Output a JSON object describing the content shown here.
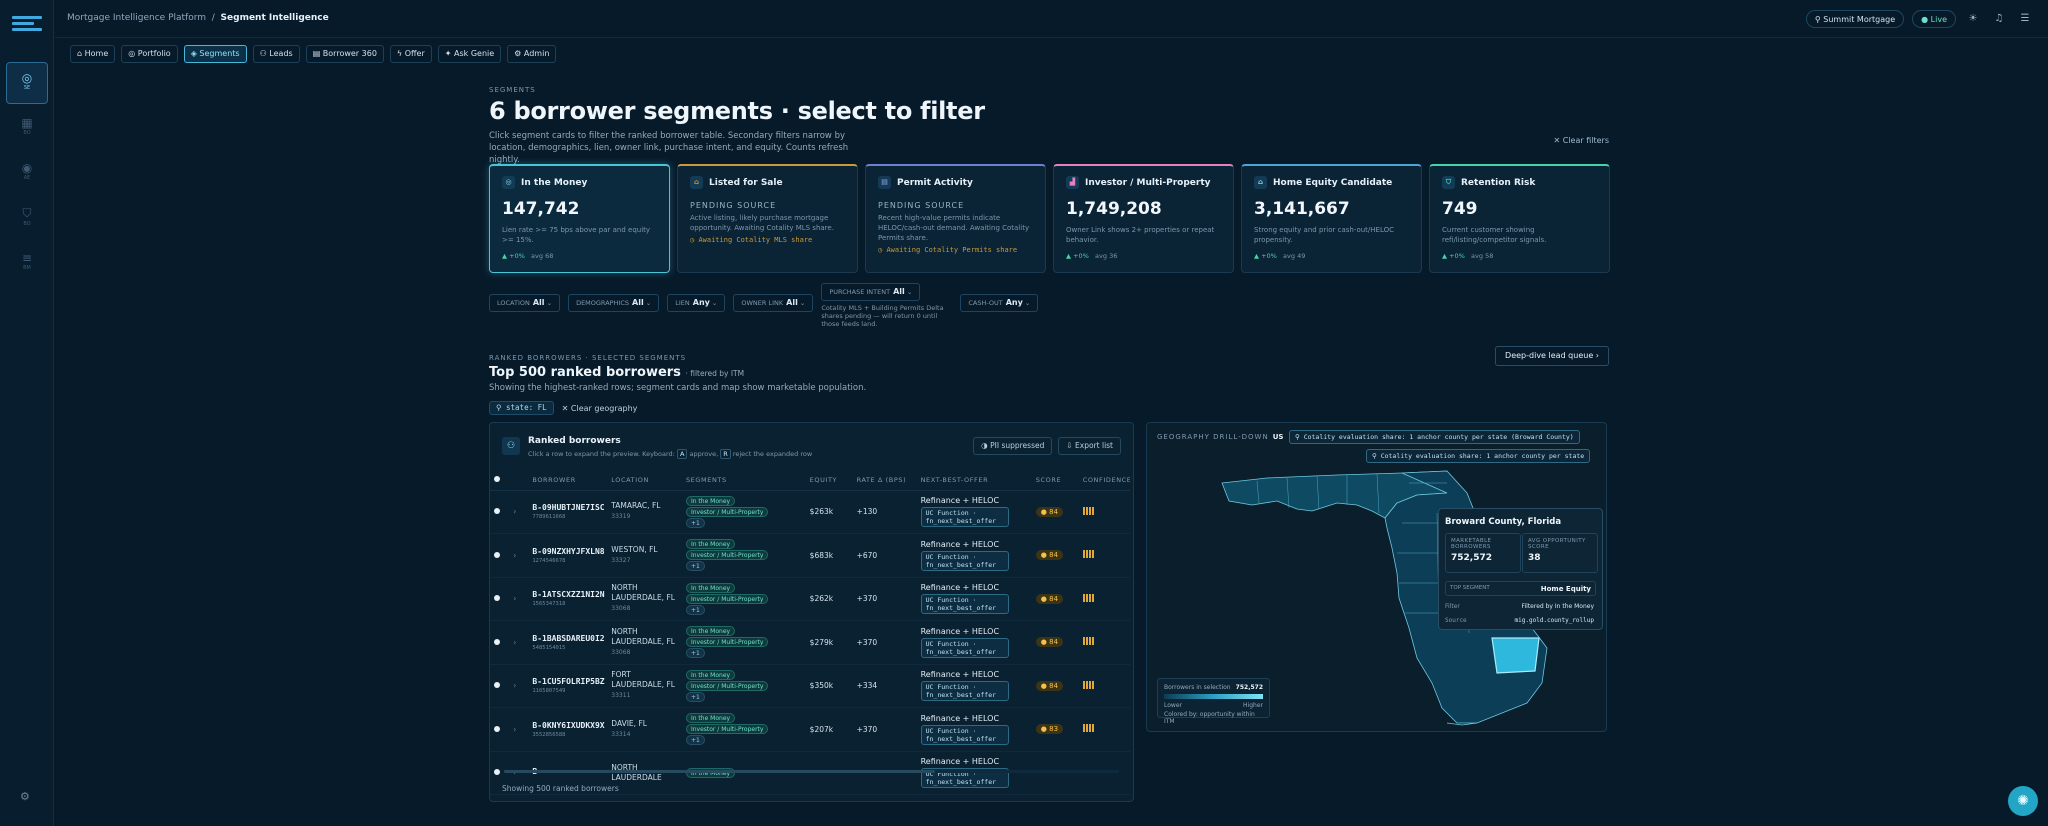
{
  "sidebar": {
    "items": [
      {
        "icon": "target-icon",
        "label": "SE"
      },
      {
        "icon": "grid-icon",
        "label": "BO"
      },
      {
        "icon": "brain-icon",
        "label": "AE"
      },
      {
        "icon": "shield-icon",
        "label": "BO"
      },
      {
        "icon": "sliders-icon",
        "label": "BM"
      }
    ]
  },
  "breadcrumb": {
    "root": "Mortgage Intelligence Platform",
    "sep": "/",
    "current": "Segment Intelligence"
  },
  "topbar": {
    "tenant": "Summit Mortgage",
    "status": "Live"
  },
  "tabs": [
    "Home",
    "Portfolio",
    "Segments",
    "Leads",
    "Borrower 360",
    "Offer",
    "Ask Genie",
    "Admin"
  ],
  "header": {
    "eyebrow": "SEGMENTS",
    "title": "6 borrower segments · select to filter",
    "subtitle": "Click segment cards to filter the ranked borrower table. Secondary filters narrow by location, demographics, lien, owner link, purchase intent, and equity. Counts refresh nightly.",
    "clear": "Clear filters"
  },
  "cards": [
    {
      "title": "In the Money",
      "value": "147,742",
      "desc": "Lien rate >= 75 bps above par and equity >= 15%.",
      "delta": "+0%",
      "avg": "avg 68",
      "accent": "#49c4d8"
    },
    {
      "title": "Listed for Sale",
      "pending": "PENDING SOURCE",
      "desc": "Active listing, likely purchase mortgage opportunity. Awaiting Cotality MLS share.",
      "await": "Awaiting Cotality MLS share",
      "accent": "#c99a3a"
    },
    {
      "title": "Permit Activity",
      "pending": "PENDING SOURCE",
      "desc": "Recent high-value permits indicate HELOC/cash-out demand. Awaiting Cotality Permits share.",
      "await": "Awaiting Cotality Permits share",
      "accent": "#6f7fd6"
    },
    {
      "title": "Investor / Multi-Property",
      "value": "1,749,208",
      "desc": "Owner Link shows 2+ properties or repeat behavior.",
      "delta": "+0%",
      "avg": "avg 36",
      "accent": "#e77fc0"
    },
    {
      "title": "Home Equity Candidate",
      "value": "3,141,667",
      "desc": "Strong equity and prior cash-out/HELOC propensity.",
      "delta": "+0%",
      "avg": "avg 49",
      "accent": "#4fa4d6"
    },
    {
      "title": "Retention Risk",
      "value": "749",
      "desc": "Current customer showing refi/listing/competitor signals.",
      "delta": "+0%",
      "avg": "avg 58",
      "accent": "#45d3a8"
    }
  ],
  "filters": [
    {
      "label": "LOCATION",
      "value": "All"
    },
    {
      "label": "DEMOGRAPHICS",
      "value": "All"
    },
    {
      "label": "LIEN",
      "value": "Any"
    },
    {
      "label": "OWNER LINK",
      "value": "All"
    },
    {
      "label": "PURCHASE INTENT",
      "value": "All",
      "note": "Cotality MLS + Building Permits Delta shares pending — will return 0 until those feeds land."
    },
    {
      "label": "CASH-OUT",
      "value": "Any"
    }
  ],
  "ranked": {
    "eyebrow": "RANKED BORROWERS · SELECTED SEGMENTS",
    "title": "Top 500 ranked borrowers",
    "title_note": "· filtered by ITM",
    "sub": "Showing the highest-ranked rows; segment cards and map show marketable population.",
    "chip_state": "state: FL",
    "clear_geo": "Clear geography",
    "deep": "Deep-dive lead queue"
  },
  "table": {
    "title": "Ranked borrowers",
    "hint_pre": "Click a row to expand the preview. Keyboard:",
    "key_a": "A",
    "hint_mid": "approve,",
    "key_r": "R",
    "hint_post": "reject the expanded row",
    "pii": "PII suppressed",
    "export": "Export list",
    "headers": [
      "",
      "",
      "BORROWER",
      "LOCATION",
      "SEGMENTS",
      "EQUITY",
      "RATE Δ (BPS)",
      "NEXT-BEST-OFFER",
      "SCORE",
      "CONFIDENCE"
    ],
    "fn_label": "UC Function · fn_next_best_offer",
    "rows": [
      {
        "id": "B-09HUBTJNE7ISC",
        "sub": "7789611668",
        "city": "TAMARAC, FL",
        "zip": "33319",
        "segs": [
          "In the Money",
          "Investor / Multi-Property",
          "+1"
        ],
        "equity": "$263k",
        "rate": "+130",
        "offer": "Refinance + HELOC",
        "score": "84"
      },
      {
        "id": "B-09NZXHYJFXLN8",
        "sub": "1274546678",
        "city": "WESTON, FL",
        "zip": "33327",
        "segs": [
          "In the Money",
          "Investor / Multi-Property",
          "+1"
        ],
        "equity": "$683k",
        "rate": "+670",
        "offer": "Refinance + HELOC",
        "score": "84"
      },
      {
        "id": "B-1ATSCXZZ1NI2N",
        "sub": "1565347318",
        "city": "NORTH LAUDERDALE, FL",
        "zip": "33068",
        "segs": [
          "In the Money",
          "Investor / Multi-Property",
          "+1"
        ],
        "equity": "$262k",
        "rate": "+370",
        "offer": "Refinance + HELOC",
        "score": "84"
      },
      {
        "id": "B-1BABSDAREU0I2",
        "sub": "5485154015",
        "city": "NORTH LAUDERDALE, FL",
        "zip": "33068",
        "segs": [
          "In the Money",
          "Investor / Multi-Property",
          "+1"
        ],
        "equity": "$279k",
        "rate": "+370",
        "offer": "Refinance + HELOC",
        "score": "84"
      },
      {
        "id": "B-1CU5FOLRIP5BZ",
        "sub": "1165807549",
        "city": "FORT LAUDERDALE, FL",
        "zip": "33311",
        "segs": [
          "In the Money",
          "Investor / Multi-Property",
          "+1"
        ],
        "equity": "$350k",
        "rate": "+334",
        "offer": "Refinance + HELOC",
        "score": "84"
      },
      {
        "id": "B-0KNY6IXUDKX9X",
        "sub": "3552856588",
        "city": "DAVIE, FL",
        "zip": "33314",
        "segs": [
          "In the Money",
          "Investor / Multi-Property",
          "+1"
        ],
        "equity": "$207k",
        "rate": "+370",
        "offer": "Refinance + HELOC",
        "score": "83"
      },
      {
        "id": "B-",
        "sub": "",
        "city": "NORTH LAUDERDALE",
        "zip": "",
        "segs": [
          "In the Money"
        ],
        "equity": "",
        "rate": "",
        "offer": "Refinance + HELOC",
        "score": ""
      }
    ],
    "footer": "Showing 500 ranked borrowers"
  },
  "geo": {
    "label": "GEOGRAPHY DRILL-DOWN",
    "us": "US",
    "sep": "›",
    "pill1": "Cotality evaluation share: 1 anchor county per state (Broward County)",
    "pill2": "Cotality evaluation share: 1 anchor county per state",
    "tip": {
      "title": "Broward County, Florida",
      "k1": "MARKETABLE BORROWERS",
      "v1": "752,572",
      "k2": "AVG OPPORTUNITY SCORE",
      "v2": "38",
      "k3": "TOP SEGMENT",
      "v3": "Home Equity",
      "k4": "Filter",
      "v4": "Filtered by In the Money",
      "k5": "Source",
      "v5": "mig.gold.county_rollup"
    },
    "legend": {
      "label": "Borrowers in selection",
      "value": "752,572",
      "lower": "Lower",
      "higher": "Higher",
      "note": "Colored by: opportunity within ITM"
    }
  },
  "colors": {
    "accent": "#49c4d8",
    "bg": "#071a2a"
  }
}
